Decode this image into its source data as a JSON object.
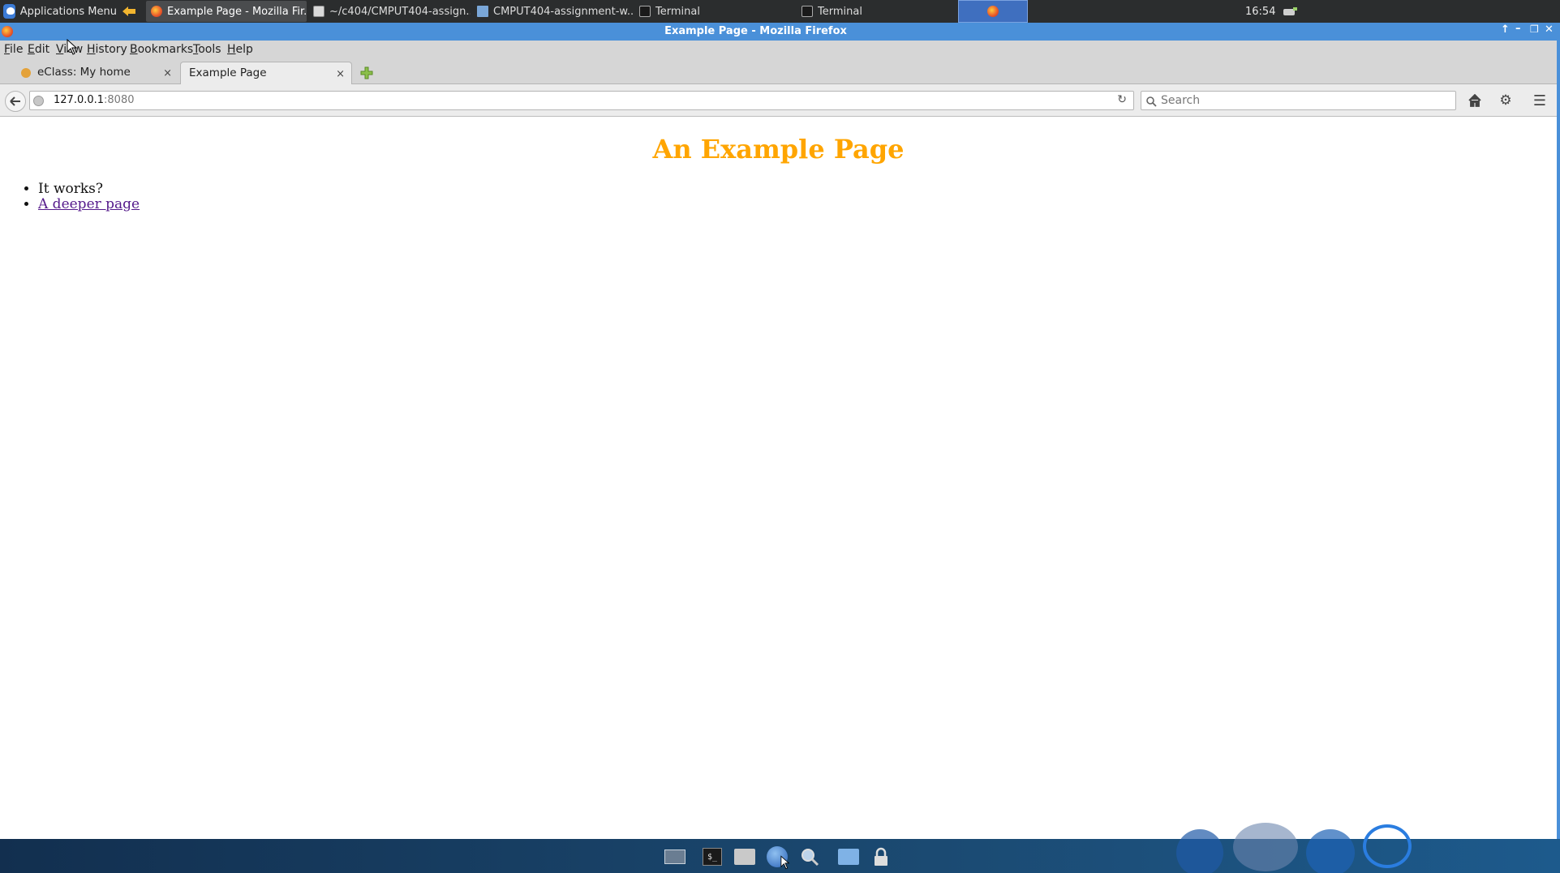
{
  "top_panel": {
    "apps_menu_label": "Applications Menu",
    "tasks": [
      {
        "label": "Example Page - Mozilla Fir...",
        "icon": "firefox-icon"
      },
      {
        "label": "~/c404/CMPUT404-assign...",
        "icon": "text-editor-icon"
      },
      {
        "label": "CMPUT404-assignment-w...",
        "icon": "folder-icon"
      },
      {
        "label": "Terminal",
        "icon": "terminal-icon"
      },
      {
        "label": "Terminal",
        "icon": "terminal-icon"
      }
    ],
    "clock": "16:54"
  },
  "window": {
    "title": "Example Page - Mozilla Firefox"
  },
  "menubar": {
    "items": [
      {
        "accel": "F",
        "rest": "ile"
      },
      {
        "accel": "E",
        "rest": "dit"
      },
      {
        "accel": "V",
        "rest": "iew"
      },
      {
        "accel": "H",
        "rest": "istory"
      },
      {
        "accel": "B",
        "rest": "ookmarks"
      },
      {
        "accel": "T",
        "rest": "ools"
      },
      {
        "accel": "H",
        "rest": "elp"
      }
    ]
  },
  "tabs": [
    {
      "label": "eClass: My home",
      "close": "×"
    },
    {
      "label": "Example Page",
      "close": "×"
    }
  ],
  "navbar": {
    "url_host": "127.0.0.1",
    "url_port": ":8080",
    "search_placeholder": "Search"
  },
  "page": {
    "heading": "An Example Page",
    "items": [
      "It works?"
    ],
    "link_label": "A deeper page"
  },
  "colors": {
    "heading": "#ffa500",
    "visited_link": "#551a8b",
    "titlebar": "#4a90d9"
  }
}
